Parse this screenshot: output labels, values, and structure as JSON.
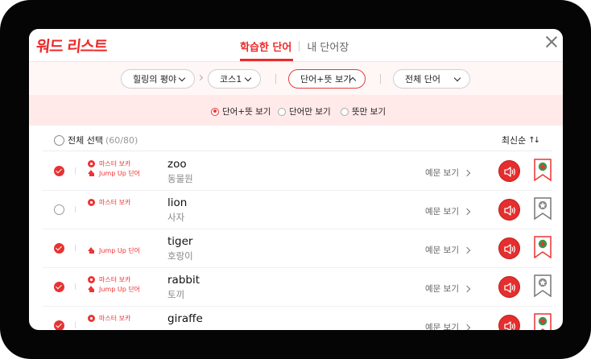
{
  "header": {
    "logo": "워드 리스트",
    "tabs": [
      {
        "label": "학습한 단어",
        "active": true
      },
      {
        "label": "내 단어장",
        "active": false
      }
    ]
  },
  "filters": {
    "book": "힐링의 평야",
    "course": "코스1",
    "view_mode": "단어+뜻 보기",
    "word_scope": "전체 단어"
  },
  "radio_options": [
    {
      "label": "단어+뜻 보기",
      "selected": true
    },
    {
      "label": "단어만 보기",
      "selected": false
    },
    {
      "label": "뜻만 보기",
      "selected": false
    }
  ],
  "list_header": {
    "select_all": "전체 선택",
    "count": "(60/80)",
    "sort": "최신순"
  },
  "example_label": "예문 보기",
  "badge_labels": {
    "master": "마스터 보카",
    "jumpup": "Jump Up 단어"
  },
  "colors": {
    "accent": "#e73232",
    "filter_bg": "#fff6f6",
    "radio_bg": "#ffe9e9"
  },
  "words": [
    {
      "checked": true,
      "master": true,
      "jumpup": true,
      "word": "zoo",
      "meaning": "동물원",
      "bookmarked": true
    },
    {
      "checked": false,
      "master": true,
      "jumpup": false,
      "word": "lion",
      "meaning": "사자",
      "bookmarked": false
    },
    {
      "checked": true,
      "master": false,
      "jumpup": true,
      "word": "tiger",
      "meaning": "호랑이",
      "bookmarked": true
    },
    {
      "checked": true,
      "master": true,
      "jumpup": true,
      "word": "rabbit",
      "meaning": "토끼",
      "bookmarked": false
    },
    {
      "checked": true,
      "master": true,
      "jumpup": false,
      "word": "giraffe",
      "meaning": "",
      "bookmarked": true
    }
  ]
}
